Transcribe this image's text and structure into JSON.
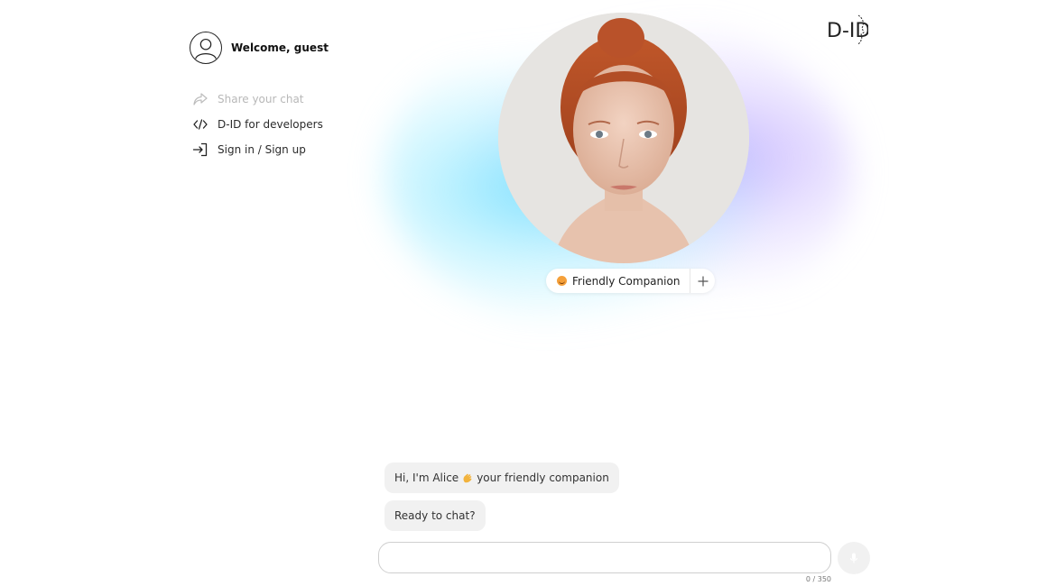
{
  "sidebar": {
    "welcome_text": "Welcome, guest",
    "items": [
      {
        "label": "Share your chat",
        "icon": "share-icon",
        "disabled": true
      },
      {
        "label": "D-ID for developers",
        "icon": "code-icon",
        "disabled": false
      },
      {
        "label": "Sign in / Sign up",
        "icon": "sign-in-icon",
        "disabled": false
      }
    ]
  },
  "brand": {
    "logo_text": "D-ID"
  },
  "persona": {
    "name": "Friendly Companion",
    "icon": "smiley-emoji-icon"
  },
  "chat": {
    "messages": [
      {
        "text_before": "Hi, I'm Alice",
        "emoji": "waving-hand-icon",
        "text_after": "your friendly companion"
      },
      {
        "text": "Ready to chat?"
      }
    ],
    "input_value": "",
    "input_placeholder": "",
    "counter": "0 / 350"
  },
  "colors": {
    "glow_cyan": "#78e1ff",
    "glow_violet": "#beaaff",
    "bubble_bg": "#f1f1f1",
    "disabled_text": "#b8b8b8"
  }
}
